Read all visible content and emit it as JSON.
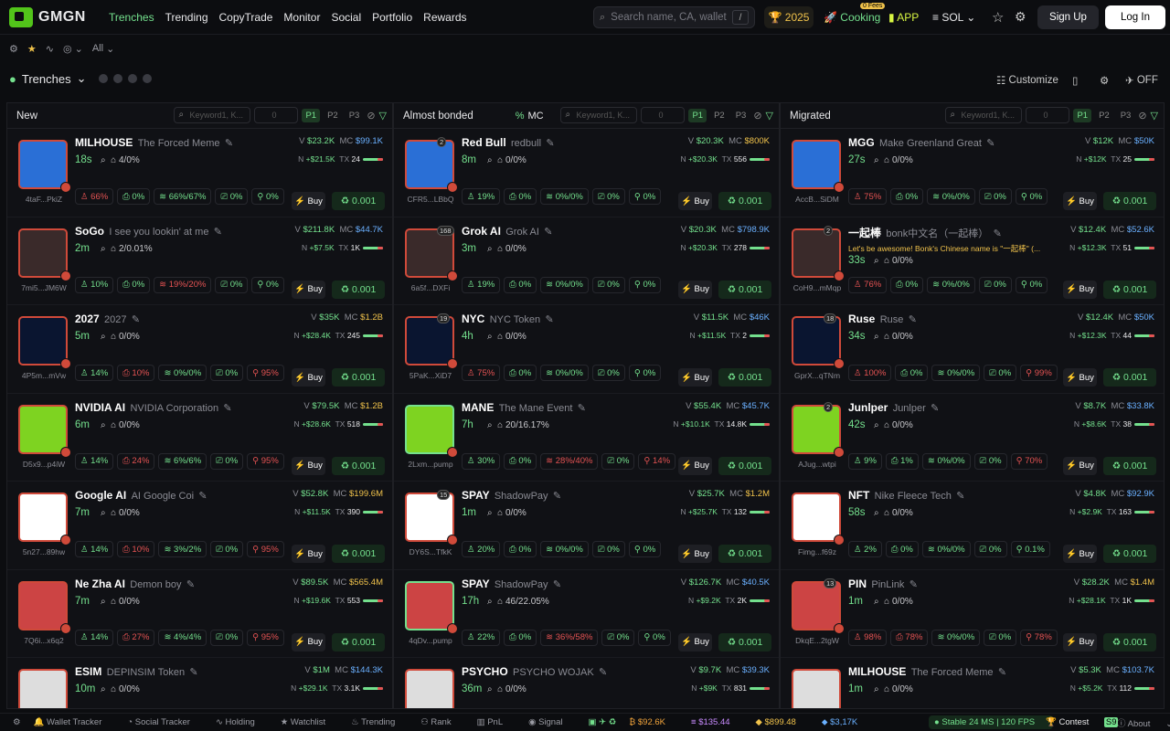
{
  "brand": {
    "name": "GMGN"
  },
  "nav": [
    "Trenches",
    "Trending",
    "CopyTrade",
    "Monitor",
    "Social",
    "Portfolio",
    "Rewards"
  ],
  "search": {
    "placeholder": "Search name, CA, wallet",
    "shortcut": "/"
  },
  "topbar": {
    "trophy": "2025",
    "cooking": "Cooking",
    "fees_badge": "0 Fees",
    "app": "APP",
    "chain": "SOL",
    "signup": "Sign Up",
    "login": "Log In"
  },
  "subbar": {
    "filter": "All"
  },
  "trenches": {
    "title": "Trenches",
    "customize": "Customize",
    "off": "OFF"
  },
  "columns": [
    {
      "title": "New",
      "kw_placeholder": "Keyword1, K...",
      "min": "0",
      "pages": [
        "P1",
        "P2",
        "P3"
      ],
      "rows": [
        {
          "name": "MILHOUSE",
          "sub": "The Forced Meme",
          "age": "18s",
          "meta": "4/0%",
          "v": "$23.2K",
          "mc": "$99.1K",
          "n": "+$21.5K",
          "tx": "24",
          "addr": "4taF...PkiZ",
          "s": [
            "66%",
            "0%",
            "66%/67%",
            "0%",
            "0%"
          ],
          "sred": [
            0
          ],
          "buy": "Buy",
          "amt": "0.001"
        },
        {
          "name": "SoGo",
          "sub": "I see you lookin' at me",
          "age": "2m",
          "meta": "2/0.01%",
          "v": "$211.8K",
          "mc": "$44.7K",
          "n": "+$7.5K",
          "tx": "1K",
          "addr": "7mi5...JM6W",
          "s": [
            "10%",
            "0%",
            "19%/20%",
            "0%",
            "0%"
          ],
          "sred": [
            2
          ],
          "buy": "Buy",
          "amt": "0.001"
        },
        {
          "name": "2027",
          "sub": "2027",
          "age": "5m",
          "meta": "0/0%",
          "v": "$35K",
          "mc": "$1.2B",
          "n": "+$28.4K",
          "tx": "245",
          "addr": "4P5m...mVw",
          "s": [
            "14%",
            "10%",
            "0%/0%",
            "0%",
            "95%"
          ],
          "sred": [
            1,
            4
          ],
          "buy": "Buy",
          "amt": "0.001"
        },
        {
          "name": "NVIDIA AI",
          "sub": "NVIDIA Corporation",
          "age": "6m",
          "meta": "0/0%",
          "v": "$79.5K",
          "mc": "$1.2B",
          "n": "+$28.6K",
          "tx": "518",
          "addr": "D5x9...p4iW",
          "s": [
            "14%",
            "24%",
            "6%/6%",
            "0%",
            "95%"
          ],
          "sred": [
            1,
            4
          ],
          "buy": "Buy",
          "amt": "0.001"
        },
        {
          "name": "Google AI",
          "sub": "AI Google Coi",
          "age": "7m",
          "meta": "0/0%",
          "v": "$52.8K",
          "mc": "$199.6M",
          "n": "+$11.5K",
          "tx": "390",
          "addr": "5n27...89hw",
          "s": [
            "14%",
            "10%",
            "3%/2%",
            "0%",
            "95%"
          ],
          "sred": [
            1,
            4
          ],
          "buy": "Buy",
          "amt": "0.001"
        },
        {
          "name": "Ne Zha AI",
          "sub": "Demon boy",
          "age": "7m",
          "meta": "0/0%",
          "v": "$89.5K",
          "mc": "$565.4M",
          "n": "+$19.6K",
          "tx": "553",
          "addr": "7Q6i...x6q2",
          "s": [
            "14%",
            "27%",
            "4%/4%",
            "0%",
            "95%"
          ],
          "sred": [
            1,
            4
          ],
          "buy": "Buy",
          "amt": "0.001"
        },
        {
          "name": "ESIM",
          "sub": "DEPINSIM Token",
          "age": "10m",
          "meta": "0/0%",
          "v": "$1M",
          "mc": "$144.3K",
          "n": "+$29.1K",
          "tx": "3.1K",
          "addr": "",
          "s": [],
          "sred": [],
          "buy": "Buy",
          "amt": "0.001"
        }
      ]
    },
    {
      "title": "Almost bonded",
      "sort": "MC",
      "kw_placeholder": "Keyword1, K...",
      "min": "0",
      "pages": [
        "P1",
        "P2",
        "P3"
      ],
      "rows": [
        {
          "name": "Red Bull",
          "sub": "redbull",
          "age": "8m",
          "meta": "0/0%",
          "v": "$20.3K",
          "mc": "$800K",
          "n": "+$20.3K",
          "tx": "556",
          "addr": "CFR5...LBbQ",
          "cnt": "2",
          "s": [
            "19%",
            "0%",
            "0%/0%",
            "0%",
            "0%"
          ],
          "sred": [],
          "buy": "Buy",
          "amt": "0.001"
        },
        {
          "name": "Grok AI",
          "sub": "Grok AI",
          "age": "3m",
          "meta": "0/0%",
          "v": "$20.3K",
          "mc": "$798.9K",
          "n": "+$20.3K",
          "tx": "278",
          "addr": "6a5f...DXFi",
          "cnt": "168",
          "s": [
            "19%",
            "0%",
            "0%/0%",
            "0%",
            "0%"
          ],
          "sred": [],
          "buy": "Buy",
          "amt": "0.001"
        },
        {
          "name": "NYC",
          "sub": "NYC Token",
          "age": "4h",
          "meta": "0/0%",
          "v": "$11.5K",
          "mc": "$46K",
          "n": "+$11.5K",
          "tx": "2",
          "addr": "5PaK...XiD7",
          "cnt": "19",
          "s": [
            "75%",
            "0%",
            "0%/0%",
            "0%",
            "0%"
          ],
          "sred": [
            0
          ],
          "buy": "Buy",
          "amt": "0.001"
        },
        {
          "name": "MANE",
          "sub": "The Mane Event",
          "age": "7h",
          "meta": "20/16.17%",
          "v": "$55.4K",
          "mc": "$45.7K",
          "n": "+$10.1K",
          "tx": "14.8K",
          "addr": "2Lxm...pump",
          "s": [
            "30%",
            "0%",
            "28%/40%",
            "0%",
            "14%"
          ],
          "sred": [
            2,
            4
          ],
          "buy": "Buy",
          "amt": "0.001"
        },
        {
          "name": "SPAY",
          "sub": "ShadowPay",
          "age": "1m",
          "meta": "0/0%",
          "v": "$25.7K",
          "mc": "$1.2M",
          "n": "+$25.7K",
          "tx": "132",
          "addr": "DY6S...TfkK",
          "cnt": "15",
          "s": [
            "20%",
            "0%",
            "0%/0%",
            "0%",
            "0%"
          ],
          "sred": [],
          "buy": "Buy",
          "amt": "0.001"
        },
        {
          "name": "SPAY",
          "sub": "ShadowPay",
          "age": "17h",
          "meta": "46/22.05%",
          "v": "$126.7K",
          "mc": "$40.5K",
          "n": "+$9.2K",
          "tx": "2K",
          "addr": "4qDv...pump",
          "s": [
            "22%",
            "0%",
            "36%/58%",
            "0%",
            "0%"
          ],
          "sred": [
            2
          ],
          "buy": "Buy",
          "amt": "0.001"
        },
        {
          "name": "PSYCHO",
          "sub": "PSYCHO WOJAK",
          "age": "36m",
          "meta": "0/0%",
          "v": "$9.7K",
          "mc": "$39.3K",
          "n": "+$9K",
          "tx": "831",
          "addr": "",
          "s": [],
          "sred": [],
          "buy": "Buy",
          "amt": "0.001"
        }
      ]
    },
    {
      "title": "Migrated",
      "kw_placeholder": "Keyword1, K...",
      "min": "0",
      "pages": [
        "P1",
        "P2",
        "P3"
      ],
      "rows": [
        {
          "name": "MGG",
          "sub": "Make Greenland Great",
          "age": "27s",
          "meta": "0/0%",
          "v": "$12K",
          "mc": "$50K",
          "n": "+$12K",
          "tx": "25",
          "addr": "AccB...SiDM",
          "s": [
            "75%",
            "0%",
            "0%/0%",
            "0%",
            "0%"
          ],
          "sred": [
            0
          ],
          "buy": "Buy",
          "amt": "0.001"
        },
        {
          "name": "一起棒",
          "sub": "bonk中文名（一起棒）",
          "age": "33s",
          "meta": "0/0%",
          "v": "$12.4K",
          "mc": "$52.6K",
          "n": "+$12.3K",
          "tx": "51",
          "addr": "CoH9...mMqp",
          "cnt": "2",
          "s": [
            "76%",
            "0%",
            "0%/0%",
            "0%",
            "0%"
          ],
          "sred": [
            0
          ],
          "buy": "Buy",
          "amt": "0.001",
          "note": "Let's be awesome! Bonk's Chinese name is \"一起棒\" (..."
        },
        {
          "name": "Ruse",
          "sub": "Ruse",
          "age": "34s",
          "meta": "0/0%",
          "v": "$12.4K",
          "mc": "$50K",
          "n": "+$12.3K",
          "tx": "44",
          "addr": "GprX...qTNm",
          "cnt": "18",
          "s": [
            "100%",
            "0%",
            "0%/0%",
            "0%",
            "99%"
          ],
          "sred": [
            0,
            4
          ],
          "buy": "Buy",
          "amt": "0.001"
        },
        {
          "name": "Junlper",
          "sub": "Junlper",
          "age": "42s",
          "meta": "0/0%",
          "v": "$8.7K",
          "mc": "$33.8K",
          "n": "+$8.6K",
          "tx": "38",
          "addr": "AJug...wtpi",
          "cnt": "2",
          "s": [
            "9%",
            "1%",
            "0%/0%",
            "0%",
            "70%"
          ],
          "sred": [
            4
          ],
          "buy": "Buy",
          "amt": "0.001"
        },
        {
          "name": "NFT",
          "sub": "Nike Fleece Tech",
          "age": "58s",
          "meta": "0/0%",
          "v": "$4.8K",
          "mc": "$92.9K",
          "n": "+$2.9K",
          "tx": "163",
          "addr": "Fimg...f69z",
          "s": [
            "2%",
            "0%",
            "0%/0%",
            "0%",
            "0.1%"
          ],
          "sred": [],
          "buy": "Buy",
          "amt": "0.001"
        },
        {
          "name": "PIN",
          "sub": "PinLink",
          "age": "1m",
          "meta": "0/0%",
          "v": "$28.2K",
          "mc": "$1.4M",
          "n": "+$28.1K",
          "tx": "1K",
          "addr": "DkqE...2tgW",
          "cnt": "13",
          "s": [
            "98%",
            "78%",
            "0%/0%",
            "0%",
            "78%"
          ],
          "sred": [
            0,
            1,
            4
          ],
          "buy": "Buy",
          "amt": "0.001"
        },
        {
          "name": "MILHOUSE",
          "sub": "The Forced Meme",
          "age": "1m",
          "meta": "0/0%",
          "v": "$5.3K",
          "mc": "$103.7K",
          "n": "+$5.2K",
          "tx": "112",
          "addr": "",
          "s": [],
          "sred": [],
          "buy": "Buy",
          "amt": "0.001"
        }
      ]
    }
  ],
  "footer": {
    "items": [
      "Wallet Tracker",
      "Social Tracker",
      "Holding",
      "Watchlist",
      "Trending",
      "Rank",
      "PnL",
      "Signal"
    ],
    "prices": [
      "$92.6K",
      "$135.44",
      "$899.48",
      "$3,17K"
    ],
    "stable": "Stable 24 MS | 120 FPS",
    "contest": "Contest",
    "season": "S9",
    "about": "About"
  }
}
